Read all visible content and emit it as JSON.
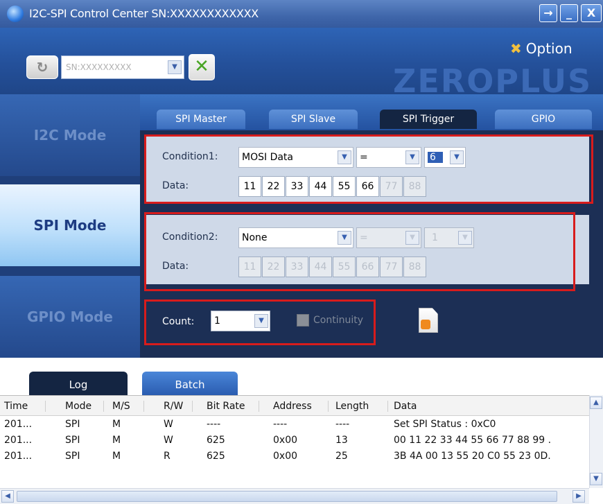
{
  "window": {
    "title": "I2C-SPI Control Center SN:XXXXXXXXXXXX",
    "pin_btn": "→",
    "min_btn": "_",
    "close_btn": "X"
  },
  "header": {
    "sn_value": "SN:XXXXXXXXX",
    "option_label": "Option",
    "brand": "ZEROPLUS"
  },
  "sidebar": {
    "modes": [
      {
        "label": "I2C Mode"
      },
      {
        "label": "SPI Mode"
      },
      {
        "label": "GPIO Mode"
      }
    ]
  },
  "tabs": [
    {
      "label": "SPI Master"
    },
    {
      "label": "SPI Slave"
    },
    {
      "label": "SPI Trigger"
    },
    {
      "label": "GPIO"
    }
  ],
  "condition1": {
    "label": "Condition1:",
    "source": "MOSI Data",
    "operator": "=",
    "length": "6",
    "data_label": "Data:",
    "bytes": [
      "11",
      "22",
      "33",
      "44",
      "55",
      "66",
      "77",
      "88"
    ]
  },
  "condition2": {
    "label": "Condition2:",
    "source": "None",
    "operator": "=",
    "length": "1",
    "data_label": "Data:",
    "bytes": [
      "11",
      "22",
      "33",
      "44",
      "55",
      "66",
      "77",
      "88"
    ]
  },
  "count": {
    "label": "Count:",
    "value": "1",
    "continuity_label": "Continuity"
  },
  "bottom_tabs": [
    {
      "label": "Log"
    },
    {
      "label": "Batch"
    }
  ],
  "log": {
    "columns": [
      "Time",
      "Mode",
      "M/S",
      "R/W",
      "Bit Rate",
      "Address",
      "Length",
      "Data"
    ],
    "rows": [
      [
        "201...",
        "SPI",
        "M",
        "W",
        "----",
        "----",
        "----",
        "Set SPI Status : 0xC0"
      ],
      [
        "201...",
        "SPI",
        "M",
        "W",
        "625",
        "0x00",
        "13",
        "00 11 22 33 44 55 66 77 88 99 ."
      ],
      [
        "201...",
        "SPI",
        "M",
        "R",
        "625",
        "0x00",
        "25",
        "3B 4A 00 13 55 20 C0 55 23 0D."
      ]
    ]
  },
  "colors": {
    "title_blue": "#3f66aa",
    "panel_navy": "#1c2f55",
    "highlight_red": "#d81c1c",
    "active_mode": "#bfe0fb"
  }
}
